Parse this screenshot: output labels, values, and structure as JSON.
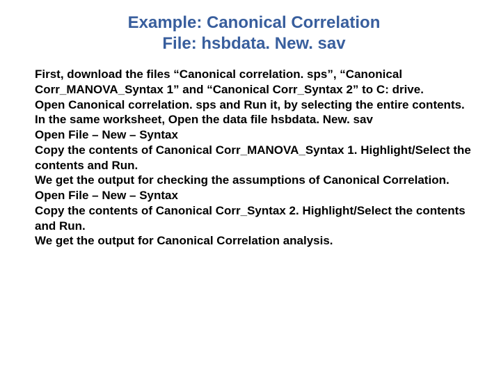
{
  "heading": {
    "line1": "Example: Canonical Correlation",
    "line2": "File: hsbdata. New. sav"
  },
  "body": {
    "p1": "First, download the files “Canonical correlation. sps”, “Canonical Corr_MANOVA_Syntax 1” and “Canonical Corr_Syntax 2” to C: drive.",
    "p2": "Open Canonical correlation. sps and Run it, by selecting the entire contents.",
    "p3": "In the same worksheet, Open the data file hsbdata. New. sav",
    "p4": "Open File – New – Syntax",
    "p5": "Copy the contents of Canonical Corr_MANOVA_Syntax 1. Highlight/Select the contents and Run.",
    "p6": "We get the output for checking the assumptions of Canonical Correlation.",
    "p7": "Open File – New – Syntax",
    "p8": "Copy the contents of Canonical Corr_Syntax 2. Highlight/Select the contents and Run.",
    "p9": "We get the output for Canonical Correlation analysis."
  }
}
